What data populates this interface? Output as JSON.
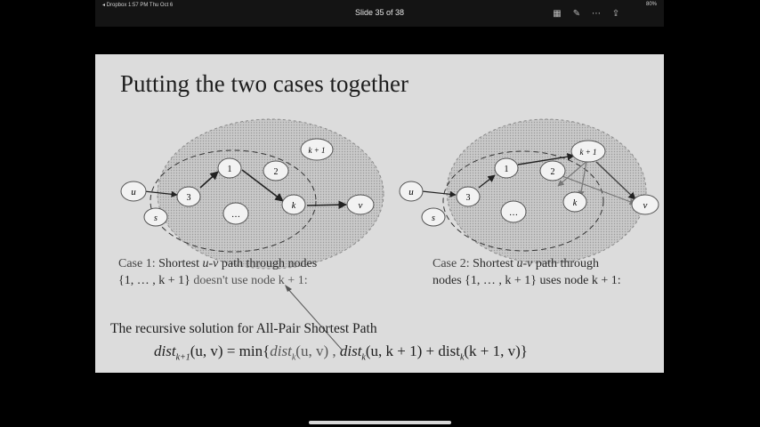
{
  "statusbar": {
    "left_text": "◂ Dropbox  1:57 PM  Thu Oct 6",
    "title": "Slide 35 of 38",
    "right_text": "80%"
  },
  "slide": {
    "title": "Putting the two cases together",
    "diagram1": {
      "nodes": {
        "u": "u",
        "s": "s",
        "n3": "3",
        "n1": "1",
        "n2": "2",
        "dots": "…",
        "k": "k",
        "kp1": "k + 1",
        "v": "v"
      }
    },
    "diagram2": {
      "nodes": {
        "u": "u",
        "s": "s",
        "n3": "3",
        "n1": "1",
        "n2": "2",
        "dots": "…",
        "k": "k",
        "kp1": "k + 1",
        "v": "v"
      }
    },
    "case1": {
      "label": "Case 1:",
      "line1_pre": "Shortest ",
      "line1_math": "u-v",
      "line1_post": " path through nodes",
      "line2_set": "{1, … , k + 1}",
      "line2_rest": " doesn't use node k + 1:"
    },
    "case2": {
      "label": "Case 2:",
      "line1_pre": "Shortest ",
      "line1_math": "u-v",
      "line1_post": " path through",
      "line2_pre": "nodes ",
      "line2_set": "{1, … , k + 1}",
      "line2_rest": " uses node k + 1:"
    },
    "recursive_text": "The recursive solution for All-Pair Shortest Path",
    "formula": {
      "lhs_fn": "dist",
      "lhs_sub": "k+1",
      "lhs_args": "(u, v) = min{",
      "t1_fn": "dist",
      "t1_sub": "k",
      "t1_args": "(u, v) , ",
      "t2_fn": "dist",
      "t2_sub": "k",
      "t2_args": "(u, k + 1)  + ",
      "t3_fn": "dist",
      "t3_sub": "k",
      "t3_args": "(k + 1, v)}"
    }
  }
}
